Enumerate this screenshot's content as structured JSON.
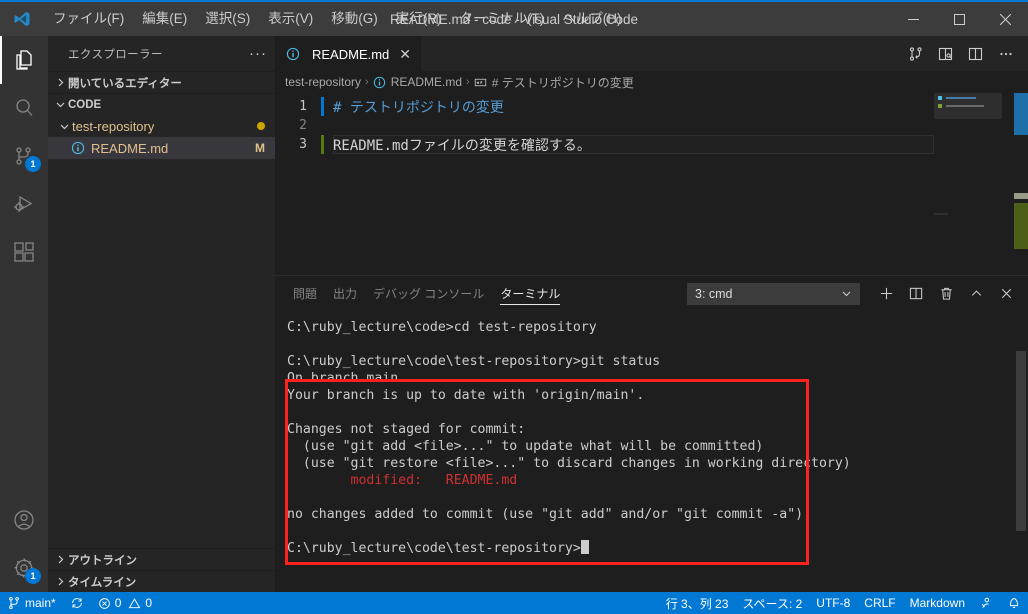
{
  "window": {
    "title": "README.md - code - Visual Studio Code",
    "minimize_label": "—",
    "maximize_label": "☐",
    "close_label": "✕"
  },
  "menubar": {
    "items": [
      {
        "label": "ファイル(F)",
        "name": "menu-file"
      },
      {
        "label": "編集(E)",
        "name": "menu-edit"
      },
      {
        "label": "選択(S)",
        "name": "menu-selection"
      },
      {
        "label": "表示(V)",
        "name": "menu-view"
      },
      {
        "label": "移動(G)",
        "name": "menu-go"
      },
      {
        "label": "実行(R)",
        "name": "menu-run"
      },
      {
        "label": "ターミナル(T)",
        "name": "menu-terminal"
      },
      {
        "label": "ヘルプ(H)",
        "name": "menu-help"
      }
    ]
  },
  "activitybar": {
    "items": [
      {
        "name": "explorer",
        "badge": ""
      },
      {
        "name": "search",
        "badge": ""
      },
      {
        "name": "source-control",
        "badge": "1"
      },
      {
        "name": "run-and-debug",
        "badge": ""
      },
      {
        "name": "extensions",
        "badge": ""
      }
    ],
    "account_badge": "",
    "settings_badge": "1"
  },
  "sidebar": {
    "title": "エクスプローラー",
    "more_actions": "···",
    "open_editors": "開いているエディター",
    "folder": "CODE",
    "project": "test-repository",
    "file": "README.md",
    "file_status": "M",
    "outline": "アウトライン",
    "timeline": "タイムライン"
  },
  "editor": {
    "tab_label": "README.md",
    "tab_close": "✕",
    "breadcrumb": [
      {
        "label": "test-repository",
        "icon": ""
      },
      {
        "label": "README.md",
        "icon": "markdown-info-icon"
      },
      {
        "label": "# テストリポジトリの変更",
        "icon": "symbol-string-icon"
      }
    ],
    "breadcrumb_separator": "›",
    "lines": [
      {
        "number": "1",
        "text": "# テストリポジトリの変更",
        "type": "heading"
      },
      {
        "number": "2",
        "text": "",
        "type": "plain"
      },
      {
        "number": "3",
        "text": "README.mdファイルの変更を確認する。",
        "type": "plain"
      }
    ]
  },
  "panel": {
    "tabs": [
      {
        "label": "問題",
        "active": false
      },
      {
        "label": "出力",
        "active": false
      },
      {
        "label": "デバッグ コンソール",
        "active": false
      },
      {
        "label": "ターミナル",
        "active": true
      }
    ],
    "terminal_select": "3: cmd",
    "select_chevron": "⌄",
    "buttons": [
      {
        "name": "new-terminal-button",
        "glyph": "+"
      },
      {
        "name": "split-terminal-button",
        "glyph": "split"
      },
      {
        "name": "kill-terminal-button",
        "glyph": "trash"
      },
      {
        "name": "maximize-panel-button",
        "glyph": "chevron-up"
      },
      {
        "name": "close-panel-button",
        "glyph": "close"
      }
    ],
    "terminal_lines": [
      {
        "text": "C:\\ruby_lecture\\code>cd test-repository",
        "color": "normal"
      },
      {
        "text": "",
        "color": "normal"
      },
      {
        "text": "C:\\ruby_lecture\\code\\test-repository>git status",
        "color": "normal"
      },
      {
        "text": "On branch main",
        "color": "normal"
      },
      {
        "text": "Your branch is up to date with 'origin/main'.",
        "color": "normal"
      },
      {
        "text": "",
        "color": "normal"
      },
      {
        "text": "Changes not staged for commit:",
        "color": "normal"
      },
      {
        "text": "  (use \"git add <file>...\" to update what will be committed)",
        "color": "normal"
      },
      {
        "text": "  (use \"git restore <file>...\" to discard changes in working directory)",
        "color": "normal"
      },
      {
        "text": "        modified:   README.md",
        "color": "red"
      },
      {
        "text": "",
        "color": "normal"
      },
      {
        "text": "no changes added to commit (use \"git add\" and/or \"git commit -a\")",
        "color": "normal"
      },
      {
        "text": "",
        "color": "normal"
      },
      {
        "text": "C:\\ruby_lecture\\code\\test-repository>",
        "color": "normal",
        "cursor": true
      }
    ]
  },
  "statusbar": {
    "branch": "main*",
    "errors": "0",
    "warnings": "0",
    "cursor_position": "行 3、列 23",
    "indentation": "スペース: 2",
    "encoding": "UTF-8",
    "eol": "CRLF",
    "language": "Markdown"
  },
  "colors": {
    "accent": "#0078d4",
    "highlight_box": "#ff2020",
    "modified_red": "#cd3131",
    "file_modified": "#e2c08d",
    "heading_blue": "#569cd6"
  }
}
